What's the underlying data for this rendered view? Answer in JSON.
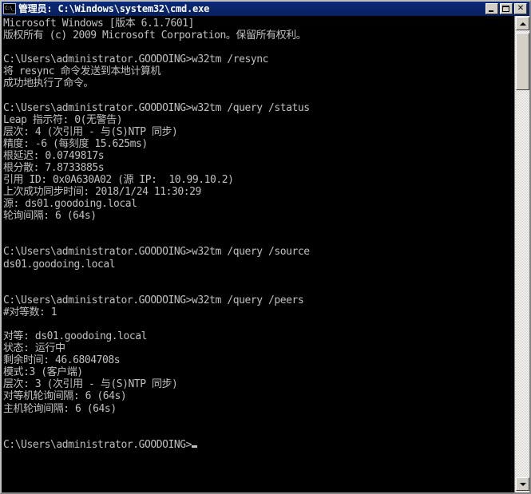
{
  "window": {
    "title": "管理员: C:\\Windows\\system32\\cmd.exe",
    "icon_name": "cmd-icon",
    "icon_glyph": "C:\\_",
    "colors": {
      "titlebar": "#0A246A",
      "title_text": "#FFFFFF",
      "console_bg": "#000000",
      "console_fg": "#C0C0C0",
      "chrome": "#D4D0C8"
    },
    "buttons": {
      "minimize": "_",
      "maximize": "□",
      "close": "✕"
    }
  },
  "scrollbar": {
    "up_arrow": "▲",
    "down_arrow": "▼",
    "thumb_label": "scroll-thumb"
  },
  "console": {
    "prompt": "C:\\Users\\administrator.GOODOING>",
    "cursor_visible": true,
    "lines": [
      "Microsoft Windows [版本 6.1.7601]",
      "版权所有 (c) 2009 Microsoft Corporation。保留所有权利。",
      "",
      "C:\\Users\\administrator.GOODOING>w32tm /resync",
      "将 resync 命令发送到本地计算机",
      "成功地执行了命令。",
      "",
      "C:\\Users\\administrator.GOODOING>w32tm /query /status",
      "Leap 指示符: 0(无警告)",
      "层次: 4 (次引用 - 与(S)NTP 同步)",
      "精度: -6 (每刻度 15.625ms)",
      "根延迟: 0.0749817s",
      "根分散: 7.8733885s",
      "引用 ID: 0x0A630A02 (源 IP:  10.99.10.2)",
      "上次成功同步时间: 2018/1/24 11:30:29",
      "源: ds01.goodoing.local",
      "轮询间隔: 6 (64s)",
      "",
      "",
      "C:\\Users\\administrator.GOODOING>w32tm /query /source",
      "ds01.goodoing.local",
      "",
      "",
      "C:\\Users\\administrator.GOODOING>w32tm /query /peers",
      "#对等数: 1",
      "",
      "对等: ds01.goodoing.local",
      "状态: 运行中",
      "剩余时间: 46.6804708s",
      "模式:3 (客户端)",
      "层次: 3 (次引用 - 与(S)NTP 同步)",
      "对等机轮询间隔: 6 (64s)",
      "主机轮询间隔: 6 (64s)",
      "",
      ""
    ],
    "final_prompt_line": "C:\\Users\\administrator.GOODOING>"
  }
}
